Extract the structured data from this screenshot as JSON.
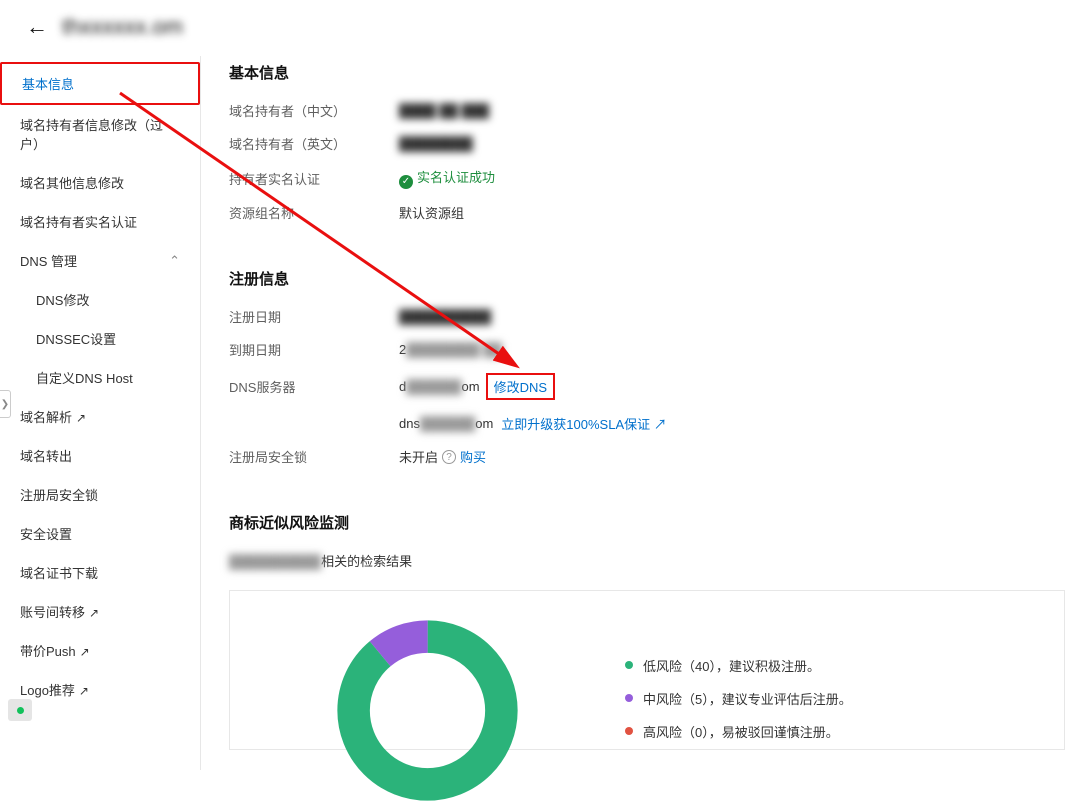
{
  "header": {
    "title_blur": "thxxxxxx.",
    "title_suffix": "om"
  },
  "sidebar": {
    "items": [
      {
        "label": "基本信息",
        "active": true
      },
      {
        "label": "域名持有者信息修改（过户）"
      },
      {
        "label": "域名其他信息修改"
      },
      {
        "label": "域名持有者实名认证"
      },
      {
        "label": "DNS 管理",
        "expandable": true
      },
      {
        "label": "DNS修改",
        "sub": true
      },
      {
        "label": "DNSSEC设置",
        "sub": true
      },
      {
        "label": "自定义DNS Host",
        "sub": true
      },
      {
        "label": "域名解析",
        "ext": true
      },
      {
        "label": "域名转出"
      },
      {
        "label": "注册局安全锁"
      },
      {
        "label": "安全设置"
      },
      {
        "label": "域名证书下载"
      },
      {
        "label": "账号间转移",
        "ext": true
      },
      {
        "label": "带价Push",
        "ext": true
      },
      {
        "label": "Logo推荐",
        "ext": true
      }
    ]
  },
  "basic_info": {
    "title": "基本信息",
    "rows": {
      "owner_cn_label": "域名持有者（中文）",
      "owner_cn_value": "████ ██ ███",
      "owner_en_label": "域名持有者（英文）",
      "owner_en_value": "████████",
      "verify_label": "持有者实名认证",
      "verify_value": "实名认证成功",
      "resource_label": "资源组名称",
      "resource_value": "默认资源组"
    }
  },
  "reg_info": {
    "title": "注册信息",
    "rows": {
      "reg_date_label": "注册日期",
      "reg_date_value": "██████████",
      "exp_date_label": "到期日期",
      "exp_date_value_prefix": "2",
      "exp_date_value_blur": "████████  ██",
      "dns_label": "DNS服务器",
      "dns1_prefix": "d",
      "dns1_blur": "██████",
      "dns1_suffix": "om",
      "modify_dns_link": "修改DNS",
      "dns2_prefix": "dns",
      "dns2_blur": "██████",
      "dns2_suffix": "om",
      "upgrade_link": "立即升级获100%SLA保证",
      "lock_label": "注册局安全锁",
      "lock_value": "未开启",
      "buy_link": "购买"
    }
  },
  "trademark": {
    "title": "商标近似风险监测",
    "subtitle_blur": "██████████",
    "subtitle_suffix": "相关的检索结果"
  },
  "chart_data": {
    "type": "pie",
    "title": "",
    "series": [
      {
        "name": "低风险",
        "value": 40,
        "color": "#2bb37a",
        "note": "建议积极注册。"
      },
      {
        "name": "中风险",
        "value": 5,
        "color": "#955edb",
        "note": "建议专业评估后注册。"
      },
      {
        "name": "高风险",
        "value": 0,
        "color": "#e15241",
        "note": "易被驳回谨慎注册。"
      }
    ],
    "legend_template": "{name}（{value}），{note}"
  }
}
